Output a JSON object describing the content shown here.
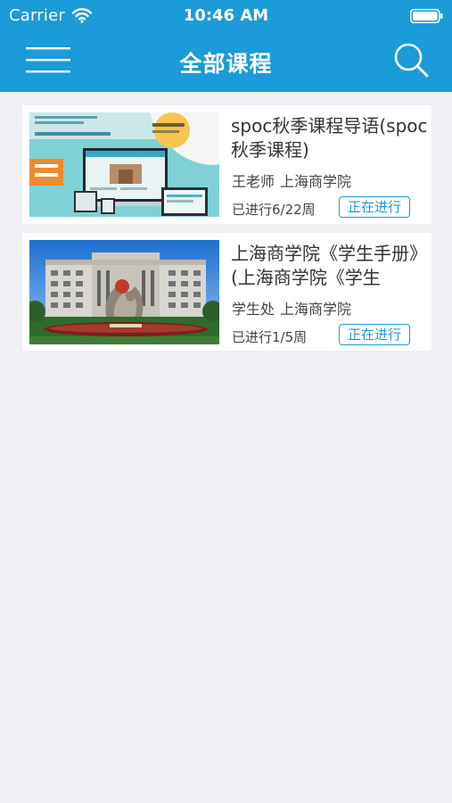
{
  "status_bar": {
    "carrier": "Carrier",
    "time": "10:46 AM",
    "wifi_icon": "wifi-icon",
    "battery_icon": "battery-icon"
  },
  "header": {
    "title": "全部课程",
    "menu_icon": "menu-icon",
    "search_icon": "search-icon",
    "background_color": "#1b9bd7"
  },
  "courses": [
    {
      "title": "spoc秋季课程导语(spoc秋季课程)",
      "teacher": "王老师",
      "school": "上海商学院",
      "progress": "已进行6/22周",
      "status": "正在进行"
    },
    {
      "title": "上海商学院《学生手册》(上海商学院《学生",
      "teacher": "学生处",
      "school": "上海商学院",
      "progress": "已进行1/5周",
      "status": "正在进行"
    }
  ],
  "colors": {
    "accent": "#1b9bd7",
    "background": "#efeff4"
  }
}
